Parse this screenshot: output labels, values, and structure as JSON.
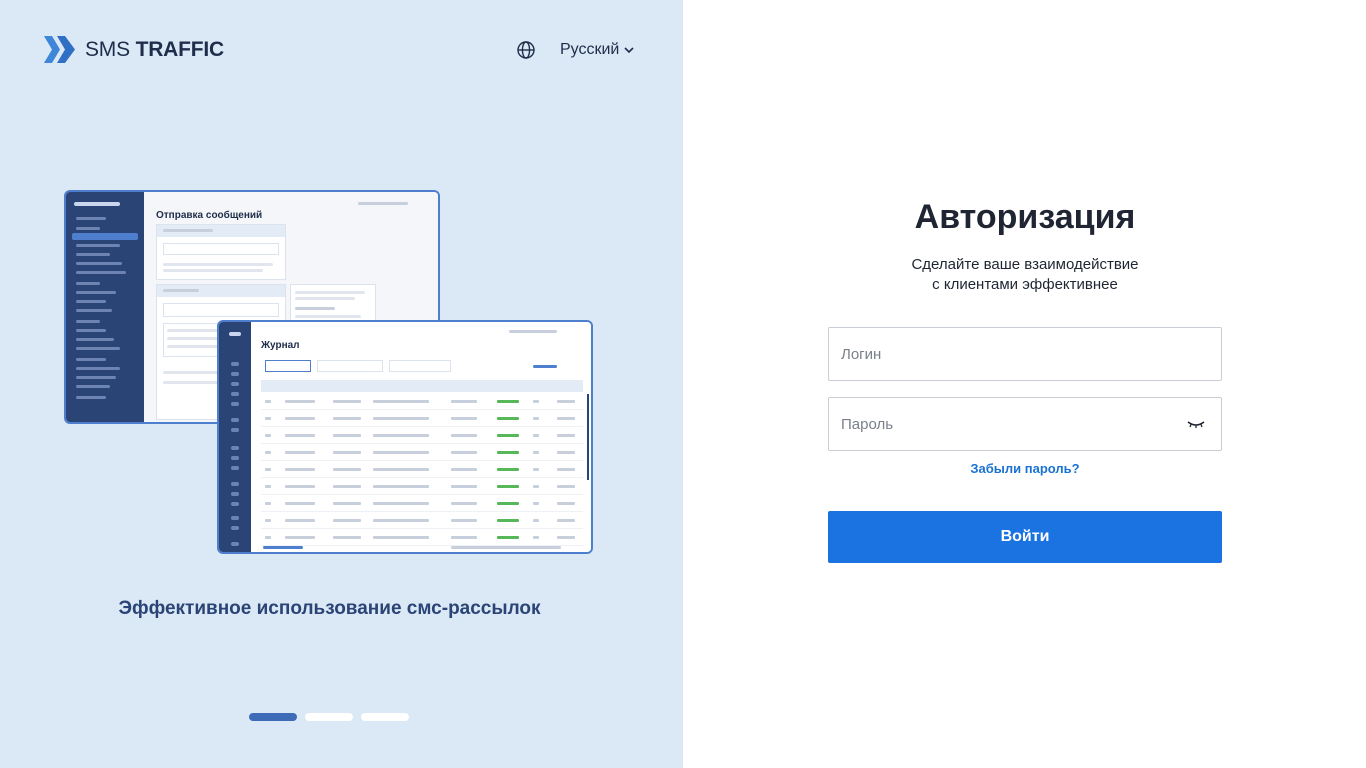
{
  "brand": {
    "logo_text_light": "SMS",
    "logo_text_bold": "TRAFFIC"
  },
  "language": {
    "icon": "globe-icon",
    "label": "Русский"
  },
  "slider": {
    "caption": "Эффективное использование смс-рассылок",
    "mock_send_title": "Отправка сообщений",
    "mock_journal_title": "Журнал",
    "active_slide": 1,
    "slide_count": 3
  },
  "auth": {
    "title": "Авторизация",
    "subtitle_line1": "Сделайте ваше взаимодействие",
    "subtitle_line2": "с клиентами эффективнее",
    "login_placeholder": "Логин",
    "password_placeholder": "Пароль",
    "forgot_label": "Забыли пароль?",
    "submit_label": "Войти"
  },
  "colors": {
    "panel_bg": "#dbe8f6",
    "accent": "#1a73e0",
    "brand_dark": "#2b4476"
  }
}
